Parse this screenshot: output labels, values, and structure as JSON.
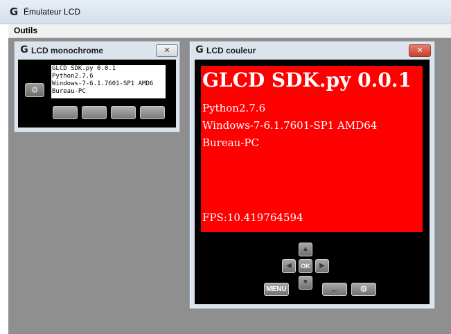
{
  "window": {
    "title": "Émulateur LCD",
    "icon": "logitech-g-icon"
  },
  "menu": {
    "items": [
      "Outils"
    ]
  },
  "mono": {
    "title": "LCD monochrome",
    "lines": [
      "GLCD SDK.py 0.0.1",
      "Python2.7.6",
      "Windows-7-6.1.7601-SP1 AMD6",
      "Bureau-PC"
    ],
    "icons": {
      "app": "logitech-g-icon",
      "close": "close-icon",
      "settings": "gear-icon"
    }
  },
  "color": {
    "title": "LCD couleur",
    "heading": "GLCD SDK.py 0.0.1",
    "lines": [
      "Python2.7.6",
      "Windows-7-6.1.7601-SP1 AMD64",
      "Bureau-PC"
    ],
    "fps": "FPS:10.419764594",
    "buttons": {
      "ok": "OK",
      "menu": "MENU"
    },
    "screen_color": "#ff0000",
    "icons": {
      "app": "logitech-g-icon",
      "close": "close-icon",
      "up": "arrow-up-icon",
      "down": "arrow-down-icon",
      "left": "arrow-left-icon",
      "right": "arrow-right-icon",
      "back": "back-arrow-icon",
      "settings": "gear-icon"
    }
  },
  "glyphs": {
    "g": "G",
    "close": "✕",
    "gear": "⚙",
    "up": "▲",
    "down": "▼",
    "left": "◀",
    "right": "▶",
    "back": "←"
  }
}
